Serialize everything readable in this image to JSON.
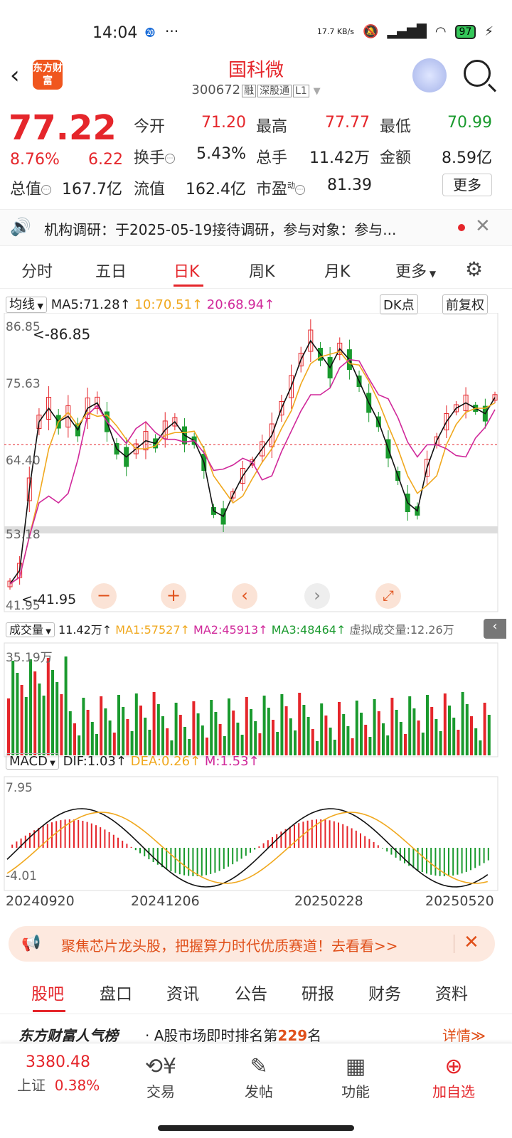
{
  "status": {
    "time": "14:04",
    "speed": "17.7 KB/s",
    "battery": "97"
  },
  "header": {
    "logo_text": "东方财富",
    "stock_name": "国科微",
    "stock_code": "300672",
    "tag1": "融",
    "tag2": "深股通",
    "tag3": "L1"
  },
  "quote": {
    "price": "77.22",
    "change_pct": "8.76%",
    "change": "6.22",
    "open_label": "今开",
    "open": "71.20",
    "high_label": "最高",
    "high": "77.77",
    "low_label": "最低",
    "low": "70.99",
    "turnover_label": "换手",
    "turnover": "5.43%",
    "volume_label": "总手",
    "volume": "11.42万",
    "amount_label": "金额",
    "amount": "8.59亿",
    "mcap_label": "总值",
    "mcap": "167.7亿",
    "float_label": "流值",
    "float": "162.4亿",
    "pe_label": "市盈",
    "pe_sup": "动",
    "pe": "81.39",
    "more": "更多"
  },
  "notice": {
    "text": "机构调研：于2025-05-19接待调研，参与对象：参与..."
  },
  "ktabs": [
    "分时",
    "五日",
    "日K",
    "周K",
    "月K",
    "更多"
  ],
  "chart_ind": {
    "ma_label": "均线",
    "ma5": "MA5:71.28↑",
    "ma10": "10:70.51↑",
    "ma20": "20:68.94↑",
    "dk": "DK点",
    "fq": "前复权"
  },
  "price_axis": {
    "top": "86.85",
    "a2": "75.63",
    "a3": "64.40",
    "a4": "53.18",
    "bottom": "41.95",
    "max_label": "<-86.85",
    "min_label": "<-41.95"
  },
  "vol_ind": {
    "label": "成交量",
    "v": "11.42万↑",
    "ma1": "MA1:57527↑",
    "ma2": "MA2:45913↑",
    "ma3": "MA3:48464↑",
    "virt": "虚拟成交量:12.26万",
    "axis_top": "35.19万"
  },
  "macd_ind": {
    "label": "MACD",
    "dif": "DIF:1.03↑",
    "dea": "DEA:0.26↑",
    "m": "M:1.53↑",
    "axis_top": "7.95",
    "axis_bot": "-4.01"
  },
  "dates": [
    "20240920",
    "20241206",
    "20250228",
    "20250520"
  ],
  "banner": {
    "text": "聚焦芯片龙头股，把握算力时代优质赛道！去看看>>"
  },
  "btabs": [
    "股吧",
    "盘口",
    "资讯",
    "公告",
    "研报",
    "财务",
    "资料"
  ],
  "popular": {
    "brand": "东方财富人气榜",
    "text": "· A股市场即时排名第",
    "rank": "229",
    "suffix": "名",
    "detail": "详情≫"
  },
  "index": {
    "value": "3380.48",
    "name": "上证",
    "pct": "0.38%"
  },
  "nav": [
    "交易",
    "发帖",
    "功能",
    "加自选"
  ],
  "chart_data": {
    "type": "candlestick",
    "price_axis_ticks": [
      86.85,
      75.63,
      64.4,
      53.18,
      41.95
    ],
    "last_close": 77.22,
    "max_marker": 86.85,
    "min_marker": 41.95,
    "x_ticks": [
      "20240920",
      "20241206",
      "20250228",
      "20250520"
    ]
  }
}
